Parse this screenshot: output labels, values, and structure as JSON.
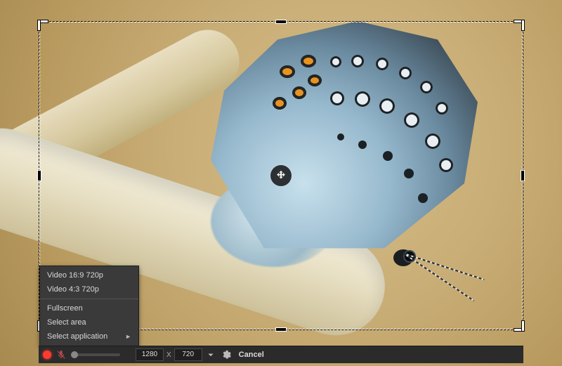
{
  "selection": {
    "width_value": "1280",
    "height_value": "720",
    "separator": "X"
  },
  "menu": {
    "preset_169": "Video 16:9 720p",
    "preset_43": "Video 4:3 720p",
    "fullscreen": "Fullscreen",
    "select_area": "Select area",
    "select_application": "Select application"
  },
  "toolbar": {
    "cancel_label": "Cancel"
  },
  "icons": {
    "move": "move-icon",
    "record": "record-icon",
    "mic_muted": "microphone-muted-icon",
    "dropdown": "chevron-down-icon",
    "settings": "gear-icon",
    "submenu_arrow": "►"
  },
  "colors": {
    "record": "#ff3b30",
    "toolbar_bg": "#2b2b2b",
    "menu_bg": "#3a3a3a"
  }
}
